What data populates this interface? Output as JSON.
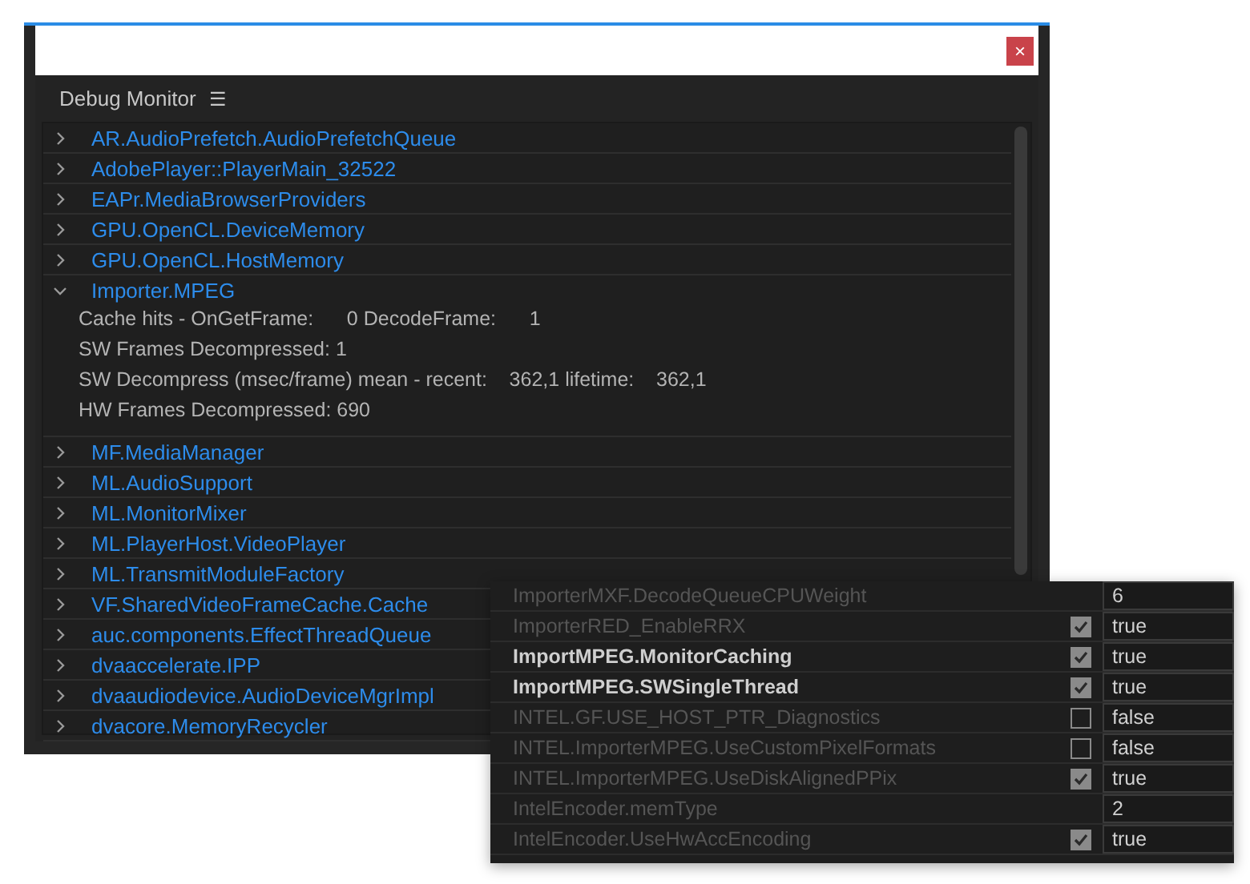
{
  "window": {
    "close_label": "×"
  },
  "panel": {
    "title": "Debug Monitor",
    "menu_glyph": "☰"
  },
  "items": [
    {
      "label": "AR.AudioPrefetch.AudioPrefetchQueue",
      "expanded": false
    },
    {
      "label": "AdobePlayer::PlayerMain_32522",
      "expanded": false
    },
    {
      "label": "EAPr.MediaBrowserProviders",
      "expanded": false
    },
    {
      "label": "GPU.OpenCL.DeviceMemory",
      "expanded": false
    },
    {
      "label": "GPU.OpenCL.HostMemory",
      "expanded": false
    },
    {
      "label": "Importer.MPEG",
      "expanded": true,
      "details": [
        "Cache hits - OnGetFrame:      0 DecodeFrame:      1",
        "SW Frames Decompressed: 1",
        "SW Decompress (msec/frame) mean - recent:    362,1 lifetime:    362,1",
        "HW Frames Decompressed: 690"
      ]
    },
    {
      "label": "MF.MediaManager",
      "expanded": false
    },
    {
      "label": "ML.AudioSupport",
      "expanded": false
    },
    {
      "label": "ML.MonitorMixer",
      "expanded": false
    },
    {
      "label": "ML.PlayerHost.VideoPlayer",
      "expanded": false
    },
    {
      "label": "ML.TransmitModuleFactory",
      "expanded": false
    },
    {
      "label": "VF.SharedVideoFrameCache.Cache",
      "expanded": false
    },
    {
      "label": "auc.components.EffectThreadQueue",
      "expanded": false
    },
    {
      "label": "dvaaccelerate.IPP",
      "expanded": false
    },
    {
      "label": "dvaaudiodevice.AudioDeviceMgrImpl",
      "expanded": false
    },
    {
      "label": "dvacore.MemoryRecycler",
      "expanded": false
    }
  ],
  "settings": [
    {
      "name": "ImporterMXF.DecodeQueueCPUWeight",
      "modified": false,
      "kind": "plain",
      "value": "6"
    },
    {
      "name": "ImporterRED_EnableRRX",
      "modified": false,
      "kind": "check",
      "checked": true,
      "value": "true"
    },
    {
      "name": "ImportMPEG.MonitorCaching",
      "modified": true,
      "kind": "check",
      "checked": true,
      "value": "true"
    },
    {
      "name": "ImportMPEG.SWSingleThread",
      "modified": true,
      "kind": "check",
      "checked": true,
      "value": "true"
    },
    {
      "name": "INTEL.GF.USE_HOST_PTR_Diagnostics",
      "modified": false,
      "kind": "check",
      "checked": false,
      "value": "false"
    },
    {
      "name": "INTEL.ImporterMPEG.UseCustomPixelFormats",
      "modified": false,
      "kind": "check",
      "checked": false,
      "value": "false"
    },
    {
      "name": "INTEL.ImporterMPEG.UseDiskAlignedPPix",
      "modified": false,
      "kind": "check",
      "checked": true,
      "value": "true"
    },
    {
      "name": "IntelEncoder.memType",
      "modified": false,
      "kind": "plain",
      "value": "2"
    },
    {
      "name": "IntelEncoder.UseHwAccEncoding",
      "modified": false,
      "kind": "check",
      "checked": true,
      "value": "true"
    }
  ]
}
